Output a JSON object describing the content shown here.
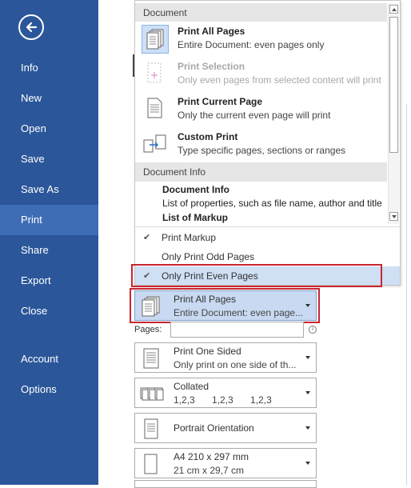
{
  "sidebar": {
    "items": [
      {
        "label": "Info"
      },
      {
        "label": "New"
      },
      {
        "label": "Open"
      },
      {
        "label": "Save"
      },
      {
        "label": "Save As"
      },
      {
        "label": "Print",
        "active": true
      },
      {
        "label": "Share"
      },
      {
        "label": "Export"
      },
      {
        "label": "Close"
      },
      {
        "label": "Account"
      },
      {
        "label": "Options"
      }
    ],
    "back_icon": "back-arrow-circle-icon"
  },
  "menu": {
    "section1": "Document",
    "items": [
      {
        "title": "Print All Pages",
        "subtitle": "Entire Document: even pages only",
        "icon": "all-pages-icon",
        "selected": true
      },
      {
        "title": "Print Selection",
        "subtitle": "Only even pages from selected content will print",
        "icon": "selection-icon",
        "disabled": true
      },
      {
        "title": "Print Current Page",
        "subtitle": "Only the current even page will print",
        "icon": "current-page-icon"
      },
      {
        "title": "Custom Print",
        "subtitle": "Type specific pages, sections or ranges",
        "icon": "custom-print-icon"
      }
    ],
    "section2": "Document Info",
    "info_title": "Document Info",
    "info_subtitle": "List of properties, such as file name, author and title",
    "info_markup": "List of Markup",
    "checks": [
      {
        "label": "Print Markup",
        "checked": true
      },
      {
        "label": "Only Print Odd Pages",
        "checked": false
      },
      {
        "label": "Only Print Even Pages",
        "checked": true,
        "highlighted": true
      }
    ]
  },
  "settings": {
    "print_pages": {
      "title": "Print All Pages",
      "subtitle": "Entire Document: even page..."
    },
    "pages_label": "Pages:",
    "pages_value": "",
    "sides": {
      "title": "Print One Sided",
      "subtitle": "Only print on one side of th..."
    },
    "collated": {
      "title": "Collated",
      "subtitle": "1,2,3    1,2,3    1,2,3"
    },
    "orientation": {
      "title": "Portrait Orientation"
    },
    "paper": {
      "title": "A4 210 x 297 mm",
      "subtitle": "21 cm x 29,7 cm"
    }
  },
  "colors": {
    "sidebar": "#2b579a",
    "sidebar_active": "#3e6db5",
    "highlight": "#cfdff4",
    "annotation_red": "#c8262f"
  }
}
